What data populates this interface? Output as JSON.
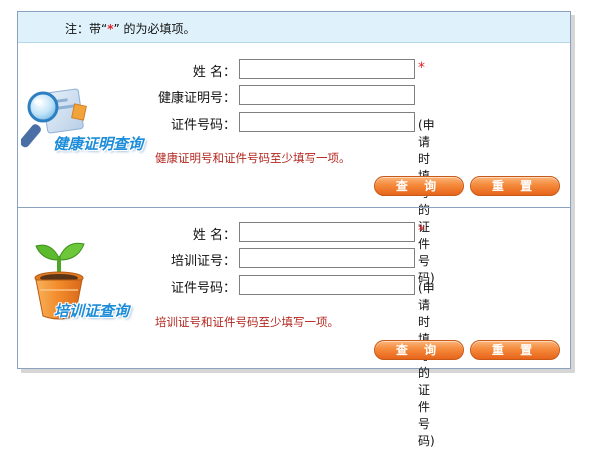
{
  "notice": {
    "prefix": "注：带",
    "open_quote": "“",
    "star": "*",
    "close_quote": "”",
    "suffix": " 的为必填项。"
  },
  "health_section": {
    "illustration_caption": "健康证明查询",
    "fields": [
      {
        "label": "姓    名：",
        "value": "",
        "required": true
      },
      {
        "label": "健康证明号：",
        "value": "",
        "required": false
      },
      {
        "label": "证件号码：",
        "value": "",
        "hint": "(申请时填写的证件号码)"
      }
    ],
    "warning": "健康证明号和证件号码至少填写一项。",
    "query_label": "查 询",
    "reset_label": "重 置"
  },
  "training_section": {
    "illustration_caption": "培训证查询",
    "fields": [
      {
        "label": "姓    名：",
        "value": "",
        "required": true
      },
      {
        "label": "培训证号：",
        "value": "",
        "required": false
      },
      {
        "label": "证件号码：",
        "value": "",
        "hint": "(申请时填写的证件号码)"
      }
    ],
    "warning": "培训证号和证件号码至少填写一项。",
    "query_label": "查 询",
    "reset_label": "重 置"
  },
  "required_mark": "*",
  "colors": {
    "notice_bg": "#dff2fb",
    "required": "#e2202a",
    "warning": "#b3261e",
    "button": "#f58a3c",
    "border": "#8aa2bf",
    "caption": "#1d8dd9"
  },
  "icons": [
    "magnifier-icon",
    "sprout-pot-icon"
  ]
}
